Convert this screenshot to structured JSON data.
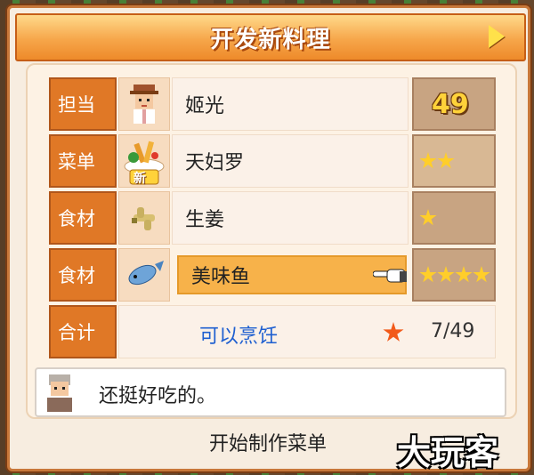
{
  "header": {
    "title": "开发新料理",
    "next_icon": "next-arrow-icon"
  },
  "rows": [
    {
      "label": "担当",
      "icon": "chef-avatar-icon",
      "name": "姬光",
      "value_type": "number",
      "value": "49"
    },
    {
      "label": "菜单",
      "icon": "tempura-dish-icon",
      "icon_badge": "新",
      "name": "天妇罗",
      "value_type": "stars",
      "stars": 2
    },
    {
      "label": "食材",
      "icon": "ginger-icon",
      "name": "生姜",
      "value_type": "stars",
      "stars": 1
    },
    {
      "label": "食材",
      "icon": "fish-icon",
      "name": "美味鱼",
      "value_type": "stars",
      "stars": 4,
      "selected": true,
      "pointer_icon": "pointing-hand-icon"
    }
  ],
  "total": {
    "label": "合计",
    "status": "可以烹饪",
    "star_icon": "star-icon",
    "count": "7/49"
  },
  "comment": {
    "avatar_icon": "customer-avatar-icon",
    "text": "还挺好吃的。"
  },
  "footer": {
    "start_label": "开始制作菜单"
  },
  "watermark": "大玩客",
  "colors": {
    "accent_orange": "#e07826",
    "title_bar": "#f6a64a",
    "status_blue": "#1e5fd0",
    "star_gold": "#ffce2a"
  }
}
